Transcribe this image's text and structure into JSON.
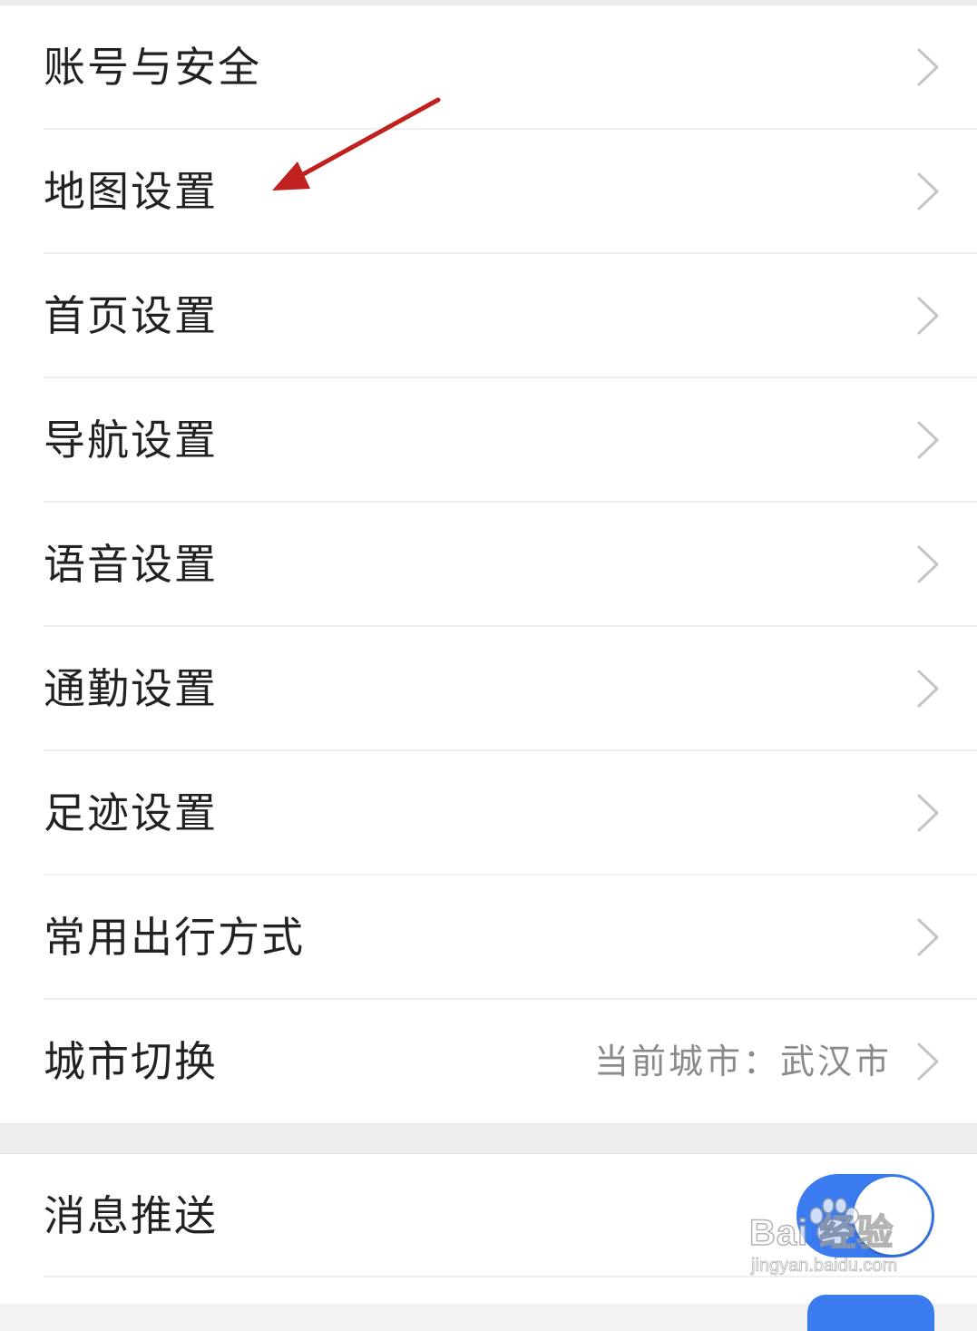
{
  "settings_list": {
    "items": [
      {
        "label": "账号与安全"
      },
      {
        "label": "地图设置"
      },
      {
        "label": "首页设置"
      },
      {
        "label": "导航设置"
      },
      {
        "label": "语音设置"
      },
      {
        "label": "通勤设置"
      },
      {
        "label": "足迹设置"
      },
      {
        "label": "常用出行方式"
      },
      {
        "label": "城市切换",
        "value": "当前城市：武汉市"
      }
    ]
  },
  "notifications": {
    "push_label": "消息推送",
    "push_enabled": true
  },
  "annotation": {
    "arrow_color": "#c0201e",
    "points_to": "地图设置"
  },
  "watermark": {
    "brand": "Bai 经验",
    "url": "jingyan.baidu.com",
    "icon": "baidu-paw-icon"
  },
  "colors": {
    "toggle_on": "#3a7bf0",
    "text_primary": "#222222",
    "text_secondary": "#8a8a8a",
    "chevron": "#c4c4c4"
  }
}
